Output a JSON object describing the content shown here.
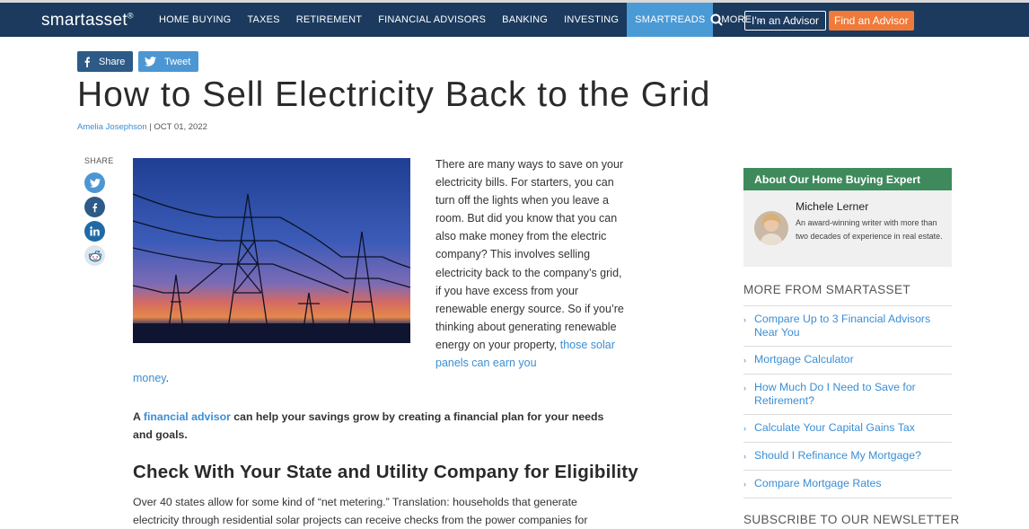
{
  "header": {
    "logo": "smartasset",
    "nav": [
      "HOME BUYING",
      "TAXES",
      "RETIREMENT",
      "FINANCIAL ADVISORS",
      "BANKING",
      "INVESTING",
      "SMARTREADS",
      "MORE"
    ],
    "active_nav": "SMARTREADS",
    "advisor_button": "I'm an Advisor",
    "find_button": "Find an Advisor",
    "accent_color": "#4a9ad6",
    "cta_color": "#f07a3a"
  },
  "share_bar": {
    "share": "Share",
    "tweet": "Tweet"
  },
  "article": {
    "title": "How to Sell Electricity Back to the Grid",
    "author": "Amelia Josephson",
    "separator": " | ",
    "date": "OCT 01, 2022",
    "share_label": "SHARE",
    "intro": "There are many ways to save on your electricity bills. For starters, you can turn off the lights when you leave a room. But did you know that you can also make money from the electric company? This involves selling electricity back to the company’s grid, if you have excess from your renewable energy source. So if you’re thinking about generating renewable energy on your property,",
    "intro_link_a": "those solar panels can earn you",
    "intro_link_b": "money",
    "intro_end": ".",
    "advisor_prefix": "A ",
    "advisor_link": "financial advisor",
    "advisor_suffix": " can help your savings grow by creating a financial plan for your needs and goals.",
    "section_heading": "Check With Your State and Utility Company for Eligibility",
    "section_para": "Over 40 states allow for some kind of “net metering.” Translation: households that generate electricity through residential solar projects can receive checks from the power companies for"
  },
  "sidebar": {
    "expert_heading": "About Our Home Buying Expert",
    "expert_name": "Michele Lerner",
    "expert_desc": "An award-winning writer with more than two decades of experience in real estate.",
    "more_heading": "MORE FROM SMARTASSET",
    "more_items": [
      "Compare Up to 3 Financial Advisors Near You",
      "Mortgage Calculator",
      "How Much Do I Need to Save for Retirement?",
      "Calculate Your Capital Gains Tax",
      "Should I Refinance My Mortgage?",
      "Compare Mortgage Rates"
    ],
    "newsletter_heading": "SUBSCRIBE TO OUR NEWSLETTER"
  }
}
